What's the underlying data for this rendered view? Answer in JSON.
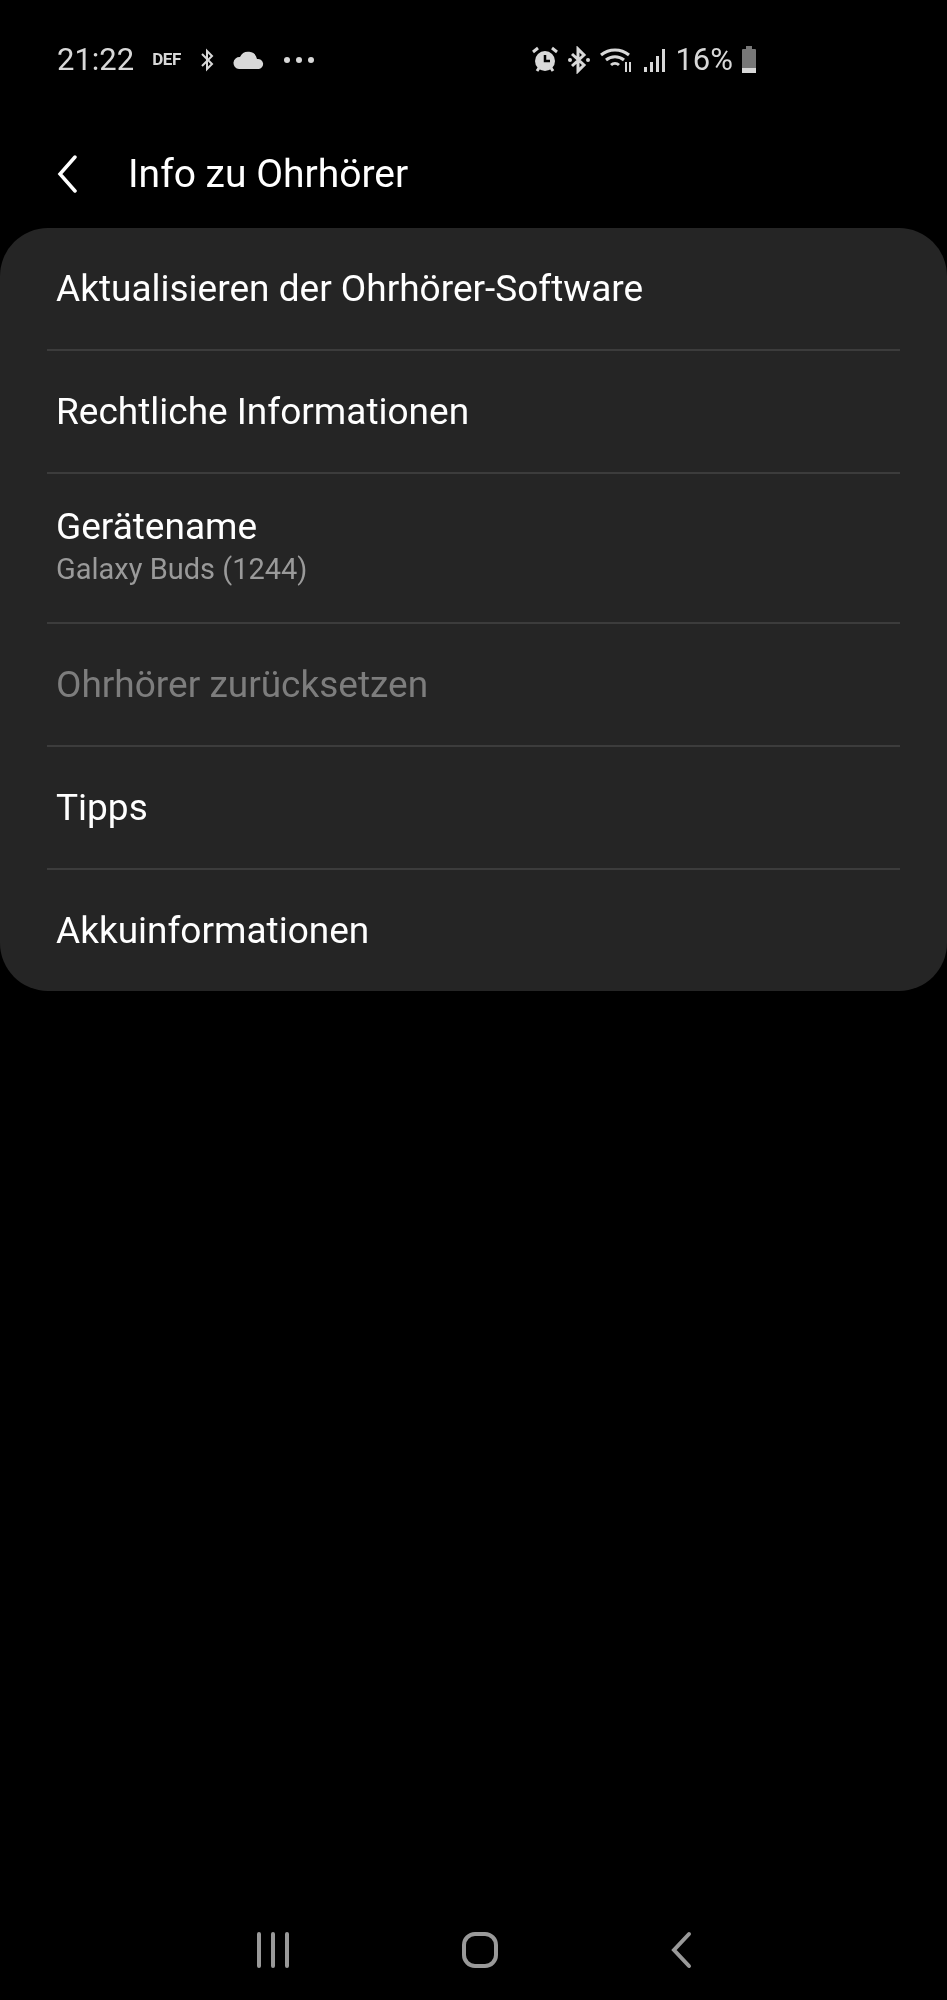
{
  "status_bar": {
    "time": "21:22",
    "carrier": "DEF",
    "battery_text": "16%"
  },
  "header": {
    "title": "Info zu Ohrhörer"
  },
  "items": [
    {
      "title": "Aktualisieren der Ohrhörer-Software",
      "disabled": false
    },
    {
      "title": "Rechtliche Informationen",
      "disabled": false
    },
    {
      "title": "Gerätename",
      "subtitle": "Galaxy Buds (1244)",
      "disabled": false
    },
    {
      "title": "Ohrhörer zurücksetzen",
      "disabled": true
    },
    {
      "title": "Tipps",
      "disabled": false
    },
    {
      "title": "Akkuinformationen",
      "disabled": false
    }
  ]
}
